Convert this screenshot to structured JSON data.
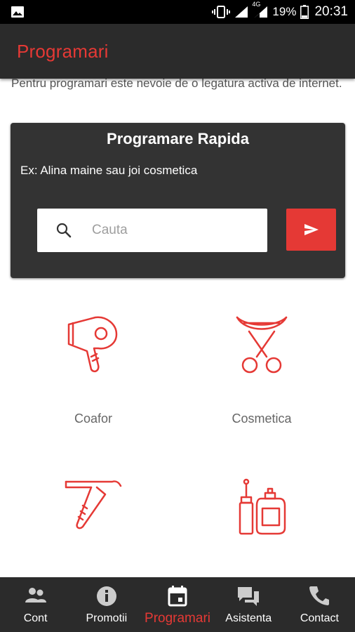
{
  "status_bar": {
    "network_label": "4G",
    "battery_percent": "19%",
    "time": "20:31"
  },
  "app_bar": {
    "title": "Programari"
  },
  "notice": "Pentru programari este nevoie de o legatura activa de internet.",
  "quick_booking": {
    "title": "Programare Rapida",
    "example": "Ex: Alina maine sau joi cosmetica",
    "search_placeholder": "Cauta",
    "search_value": ""
  },
  "categories": [
    {
      "label": "Coafor",
      "icon": "hair-dryer-icon"
    },
    {
      "label": "Cosmetica",
      "icon": "eyelash-curler-icon"
    },
    {
      "label": "",
      "icon": "straight-razor-icon"
    },
    {
      "label": "",
      "icon": "nail-polish-perfume-icon"
    }
  ],
  "bottom_nav": {
    "items": [
      {
        "label": "Cont",
        "icon": "people-icon"
      },
      {
        "label": "Promotii",
        "icon": "info-icon"
      },
      {
        "label": "Programari",
        "icon": "calendar-icon"
      },
      {
        "label": "Asistenta",
        "icon": "chat-icon"
      },
      {
        "label": "Contact",
        "icon": "phone-icon"
      }
    ],
    "active": "Programari"
  },
  "colors": {
    "accent": "#e53935",
    "app_bar": "#2b2b2b",
    "card": "#333333"
  }
}
